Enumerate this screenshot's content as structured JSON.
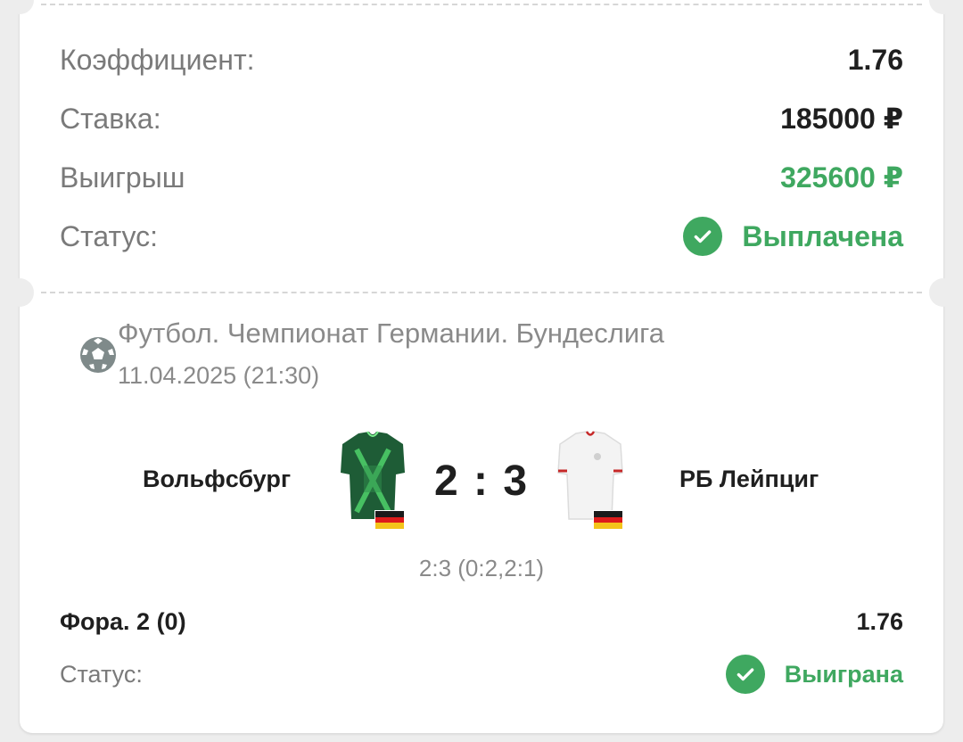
{
  "summary": {
    "coefficient_label": "Коэффициент:",
    "coefficient_value": "1.76",
    "stake_label": "Ставка:",
    "stake_value": "185000 ₽",
    "win_label": "Выигрыш",
    "win_value": "325600 ₽",
    "status_label": "Статус:",
    "status_value": "Выплачена",
    "status_icon": "check-circle-icon"
  },
  "event": {
    "sport_icon": "soccer-ball-icon",
    "league": "Футбол. Чемпионат Германии. Бундеслига",
    "datetime": "11.04.2025 (21:30)",
    "home_team": "Вольфсбург",
    "away_team": "РБ Лейпциг",
    "score": "2 : 3",
    "score_detail": "2:3 (0:2,2:1)",
    "home_flag": "germany-flag",
    "away_flag": "germany-flag"
  },
  "bet": {
    "market": "Фора. 2 (0)",
    "odds": "1.76",
    "status_label": "Статус:",
    "status_value": "Выиграна",
    "status_icon": "check-circle-icon"
  },
  "colors": {
    "accent_green": "#3fa860",
    "home_jersey": "#1f6b3a",
    "away_jersey": "#f4f4f4"
  }
}
